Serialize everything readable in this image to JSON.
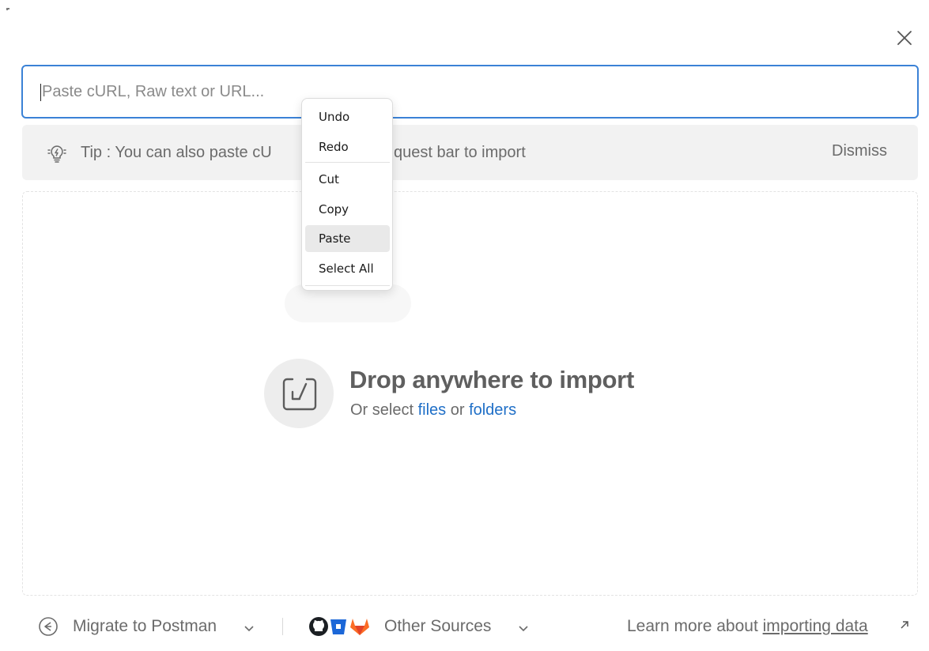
{
  "dialog": {
    "close_icon": "close-icon"
  },
  "url_input": {
    "placeholder": "Paste cURL, Raw text or URL...",
    "value": ""
  },
  "tip": {
    "icon": "lightbulb-icon",
    "text_left": "Tip : You can also paste cU",
    "text_right": "quest bar to import",
    "dismiss_label": "Dismiss"
  },
  "drop_zone": {
    "icon": "import-tray-icon",
    "title": "Drop anywhere to import",
    "sub_prefix": "Or select ",
    "files_link": "files",
    "sub_middle": " or ",
    "folders_link": "folders"
  },
  "footer": {
    "migrate": {
      "icon": "migrate-icon",
      "label": "Migrate to Postman"
    },
    "other_sources": {
      "icons": [
        "github-icon",
        "bitbucket-icon",
        "gitlab-icon"
      ],
      "label": "Other Sources"
    },
    "learn_more": {
      "prefix": "Learn more about ",
      "link": "importing data",
      "icon": "external-link-icon"
    }
  },
  "context_menu": {
    "items": [
      {
        "label": "Undo"
      },
      {
        "label": "Redo"
      },
      {
        "label": "Cut"
      },
      {
        "label": "Copy"
      },
      {
        "label": "Paste",
        "highlighted": true
      },
      {
        "label": "Select All"
      }
    ]
  },
  "colors": {
    "accent": "#3b82d6",
    "link": "#1f6fc7",
    "tip_bg": "#f2f2f2",
    "muted_text": "#6b6b6b"
  }
}
